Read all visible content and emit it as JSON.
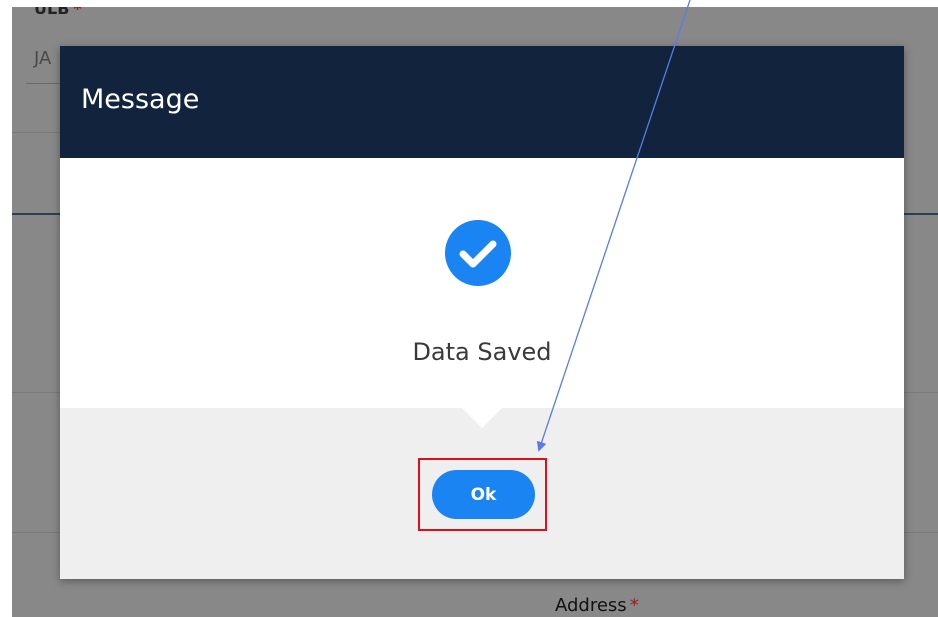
{
  "background": {
    "ulb_label": "ULB",
    "required_mark": "*",
    "ulb_value": "JA",
    "address_label": "Address"
  },
  "dialog": {
    "title": "Message",
    "icon": "check-circle-icon",
    "message": "Data Saved",
    "ok_label": "Ok"
  },
  "colors": {
    "header": "#12233d",
    "ok_button": "#1a84f2",
    "highlight_box": "#e10e1a",
    "arrow": "#5b7be6",
    "footer": "#efefef"
  }
}
